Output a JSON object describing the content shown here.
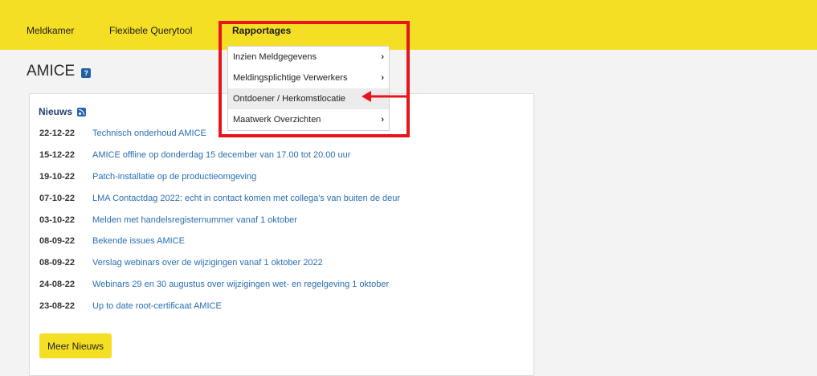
{
  "nav": {
    "items": [
      {
        "label": "Meldkamer"
      },
      {
        "label": "Flexibele Querytool"
      },
      {
        "label": "Rapportages"
      }
    ]
  },
  "page": {
    "title": "AMICE",
    "help_icon": "question-mark-icon",
    "help_glyph": "?"
  },
  "news": {
    "heading": "Nieuws",
    "rss_icon": "rss-icon",
    "items": [
      {
        "date": "22-12-22",
        "title": "Technisch onderhoud AMICE"
      },
      {
        "date": "15-12-22",
        "title": "AMICE offline op donderdag 15 december van 17.00 tot 20.00 uur"
      },
      {
        "date": "19-10-22",
        "title": "Patch-installatie op de productieomgeving"
      },
      {
        "date": "07-10-22",
        "title": "LMA Contactdag 2022: echt in contact komen met collega's van buiten de deur"
      },
      {
        "date": "03-10-22",
        "title": "Melden met handelsregisternummer vanaf 1 oktober"
      },
      {
        "date": "08-09-22",
        "title": "Bekende issues AMICE"
      },
      {
        "date": "08-09-22",
        "title": "Verslag webinars over de wijzigingen vanaf 1 oktober 2022"
      },
      {
        "date": "24-08-22",
        "title": "Webinars 29 en 30 augustus over wijzigingen wet- en regelgeving 1 oktober"
      },
      {
        "date": "23-08-22",
        "title": "Up to date root-certificaat AMICE"
      }
    ],
    "more_label": "Meer Nieuws"
  },
  "dropdown": {
    "items": [
      {
        "label": "Inzien Meldgegevens",
        "submenu": true
      },
      {
        "label": "Meldingsplichtige Verwerkers",
        "submenu": true
      },
      {
        "label": "Ontdoener / Herkomstlocatie",
        "submenu": false
      },
      {
        "label": "Maatwerk Overzichten",
        "submenu": true
      }
    ],
    "chevron": "›"
  },
  "colors": {
    "topbar": "#f5df24",
    "link": "#2a6fb0",
    "annotation": "#e8141c"
  }
}
